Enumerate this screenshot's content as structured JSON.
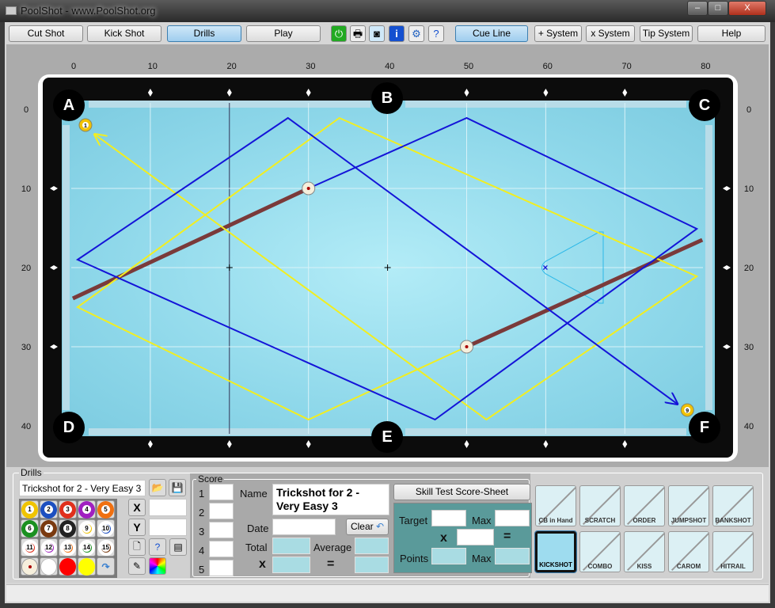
{
  "window": {
    "title": "PoolShot - www.PoolShot.org",
    "min": "–",
    "max": "□",
    "close": "X"
  },
  "toolbar": {
    "cut_shot": "Cut Shot",
    "kick_shot": "Kick Shot",
    "drills": "Drills",
    "play": "Play",
    "cue_line": "Cue Line",
    "plus_system": "+ System",
    "x_system": "x System",
    "tip_system": "Tip System",
    "help": "Help",
    "icons": [
      "power-icon",
      "print-icon",
      "camera-icon",
      "info-icon",
      "settings-icon",
      "help-doc-icon"
    ]
  },
  "table": {
    "x_ticks": [
      "0",
      "10",
      "20",
      "30",
      "40",
      "50",
      "60",
      "70",
      "80"
    ],
    "y_ticks": [
      "0",
      "10",
      "20",
      "30",
      "40"
    ],
    "pockets": [
      "A",
      "B",
      "C",
      "D",
      "E",
      "F"
    ],
    "balls": [
      {
        "label": "cue",
        "x": 30,
        "y": 10
      },
      {
        "label": "cue",
        "x": 50,
        "y": 30
      },
      {
        "label": "1",
        "x": 1.8,
        "y": 2,
        "color": "#f2c200"
      },
      {
        "label": "9",
        "x": 77.9,
        "y": 38,
        "color": "#f2c200"
      }
    ],
    "blue_path": [
      [
        30,
        10
      ],
      [
        50,
        1.1
      ],
      [
        79.1,
        15.1
      ],
      [
        46,
        39.2
      ],
      [
        0.8,
        19
      ],
      [
        27.4,
        1.1
      ],
      [
        76.6,
        37.2
      ]
    ],
    "yellow_path": [
      [
        50,
        30
      ],
      [
        30,
        39.2
      ],
      [
        0.8,
        25
      ],
      [
        33.9,
        1.1
      ],
      [
        79.1,
        21.1
      ],
      [
        52.5,
        39.2
      ],
      [
        3,
        3.2
      ]
    ],
    "cue_lines": [
      [
        [
          0.2,
          23.9
        ],
        [
          30,
          10
        ]
      ],
      [
        [
          50,
          30
        ],
        [
          79.8,
          16.5
        ]
      ]
    ],
    "ball_in_hand_mark": {
      "x": 60,
      "y": 20
    },
    "colors": {
      "blue": "#1414d8",
      "yellow": "#f2ee20",
      "cue": "#7a3a3a",
      "region": "#2cb8e8"
    }
  },
  "drills": {
    "legend": "Drills",
    "name": "Trickshot for 2 - Very Easy 3",
    "x_label": "X",
    "y_label": "Y",
    "x_value": "",
    "y_value": "",
    "balls": [
      "1",
      "2",
      "3",
      "4",
      "5",
      "6",
      "7",
      "8",
      "9",
      "10",
      "11",
      "12",
      "13",
      "14",
      "15"
    ],
    "ball_colors": [
      "#f0c400",
      "#1c4fc0",
      "#e0301c",
      "#a020c0",
      "#f07010",
      "#1a9020",
      "#7a3a10",
      "#222",
      "#f0c400",
      "#1c4fc0",
      "#e0301c",
      "#a020c0",
      "#f07010",
      "#1a9020",
      "#7a3a10"
    ]
  },
  "score": {
    "legend": "Score",
    "rows": [
      "1",
      "2",
      "3",
      "4",
      "5"
    ],
    "name_label": "Name",
    "name_value": "Trickshot for 2 - Very Easy 3",
    "date_label": "Date",
    "clear": "Clear",
    "total_label": "Total",
    "average_label": "Average",
    "x_label": "x",
    "eq_label": "="
  },
  "skill": {
    "button": "Skill Test Score-Sheet",
    "target": "Target",
    "max": "Max",
    "x": "x",
    "eq": "=",
    "points": "Points",
    "max2": "Max"
  },
  "shot_types": [
    {
      "label": "CB in Hand",
      "active": false
    },
    {
      "label": "SCRATCH",
      "active": false
    },
    {
      "label": "ORDER",
      "active": false
    },
    {
      "label": "JUMPSHOT",
      "active": false
    },
    {
      "label": "BANKSHOT",
      "active": false
    },
    {
      "label": "KICKSHOT",
      "active": true
    },
    {
      "label": "COMBO",
      "active": false
    },
    {
      "label": "KISS",
      "active": false
    },
    {
      "label": "CAROM",
      "active": false
    },
    {
      "label": "HITRAIL",
      "active": false
    }
  ]
}
